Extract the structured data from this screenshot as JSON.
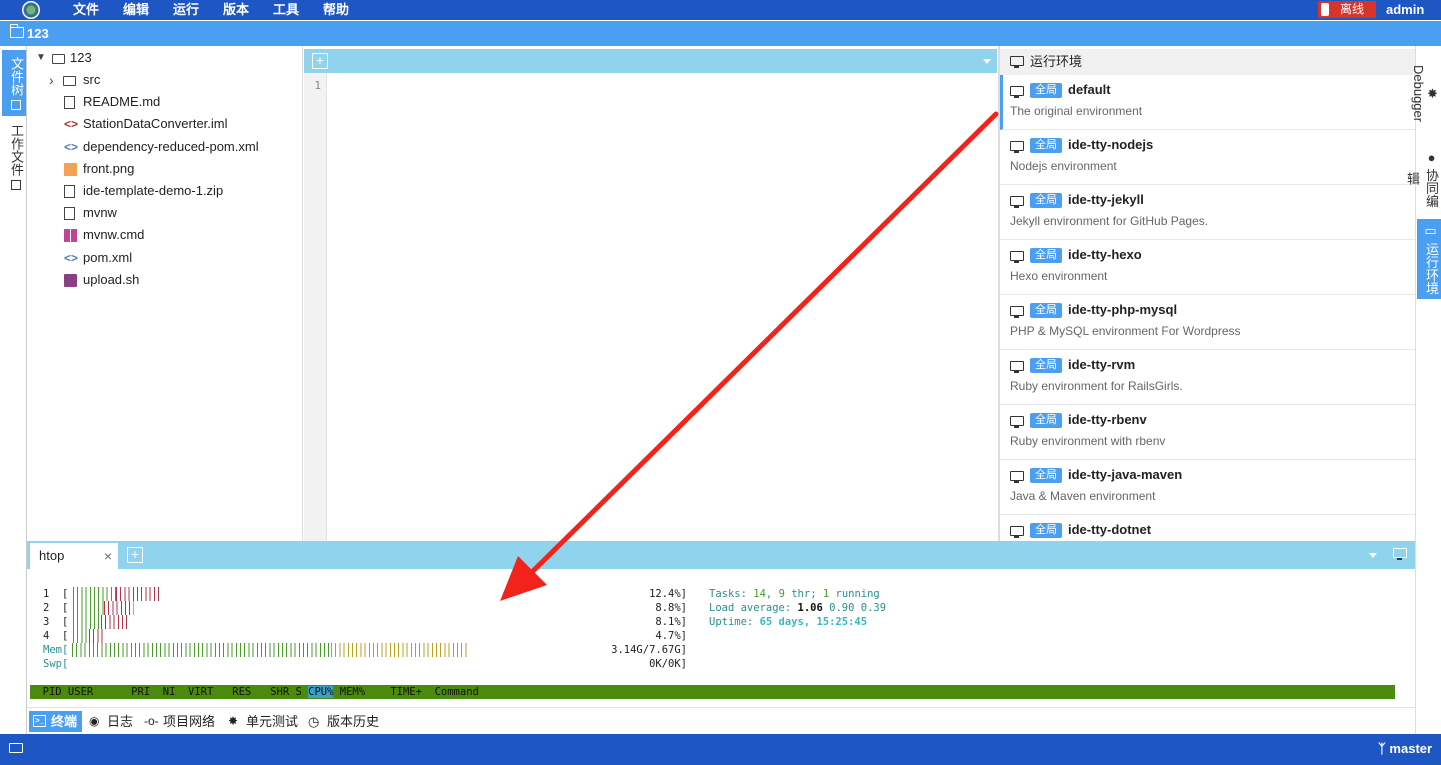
{
  "menubar": {
    "items": [
      "文件",
      "编辑",
      "运行",
      "版本",
      "工具",
      "帮助"
    ],
    "offline_label": "离线",
    "user": "admin"
  },
  "pathbar": {
    "path": "123"
  },
  "left_rail": {
    "tabs": [
      "文件树",
      "工作文件"
    ]
  },
  "right_rail": {
    "tabs": [
      "Debugger",
      "协同编辑",
      "运行环境"
    ]
  },
  "filetree": {
    "root": "123",
    "items": [
      {
        "name": "src",
        "icon": "folder-icon"
      },
      {
        "name": "README.md",
        "icon": "markdown-icon"
      },
      {
        "name": "StationDataConverter.iml",
        "icon": "iml-icon"
      },
      {
        "name": "dependency-reduced-pom.xml",
        "icon": "xml-icon"
      },
      {
        "name": "front.png",
        "icon": "image-icon"
      },
      {
        "name": "ide-template-demo-1.zip",
        "icon": "zip-icon"
      },
      {
        "name": "mvnw",
        "icon": "file-icon"
      },
      {
        "name": "mvnw.cmd",
        "icon": "windows-icon"
      },
      {
        "name": "pom.xml",
        "icon": "xml-icon"
      },
      {
        "name": "upload.sh",
        "icon": "shell-icon"
      }
    ]
  },
  "editor": {
    "line_number": "1"
  },
  "env_panel": {
    "title": "运行环境",
    "badge": "全局",
    "items": [
      {
        "name": "default",
        "desc": "The original environment"
      },
      {
        "name": "ide-tty-nodejs",
        "desc": "Nodejs environment"
      },
      {
        "name": "ide-tty-jekyll",
        "desc": "Jekyll environment for GitHub Pages."
      },
      {
        "name": "ide-tty-hexo",
        "desc": "Hexo environment"
      },
      {
        "name": "ide-tty-php-mysql",
        "desc": "PHP & MySQL environment For Wordpress"
      },
      {
        "name": "ide-tty-rvm",
        "desc": "Ruby environment for RailsGirls."
      },
      {
        "name": "ide-tty-rbenv",
        "desc": "Ruby environment with rbenv"
      },
      {
        "name": "ide-tty-java-maven",
        "desc": "Java & Maven environment"
      },
      {
        "name": "ide-tty-dotnet",
        "desc": ""
      }
    ]
  },
  "terminal": {
    "tab": "htop",
    "cpus": [
      {
        "id": "1",
        "pct": "12.4%]",
        "load": 0.124
      },
      {
        "id": "2",
        "pct": "8.8%]",
        "load": 0.088
      },
      {
        "id": "3",
        "pct": "8.1%]",
        "load": 0.081
      },
      {
        "id": "4",
        "pct": "4.7%]",
        "load": 0.047
      }
    ],
    "mem": {
      "label": "Mem[",
      "value": "3.14G/7.67G]"
    },
    "swp": {
      "label": "Swp[",
      "value": "0K/0K]"
    },
    "tasks_label": "Tasks: ",
    "tasks": "14",
    "thr": "9",
    "thr_label": " thr; ",
    "running": "1",
    "running_label": " running",
    "load_label": "Load average: ",
    "load1": "1.06",
    "load5": "0.90",
    "load15": "0.39",
    "uptime_label": "Uptime: ",
    "uptime": "65 days, 15:25:45",
    "header": {
      "pre": "  PID USER      PRI  NI  VIRT   RES   SHR S ",
      "cpu": "CPU%",
      "post": " MEM%    TIME+  Command"
    }
  },
  "bottom_tabs": [
    "终端",
    "日志",
    "项目网络",
    "单元测试",
    "版本历史"
  ],
  "status": {
    "branch": "master"
  },
  "colors": {
    "primary": "#1e56c4",
    "accent": "#4b9ff0",
    "tabbar": "#8fd3ec",
    "arrow": "#f2231b"
  }
}
